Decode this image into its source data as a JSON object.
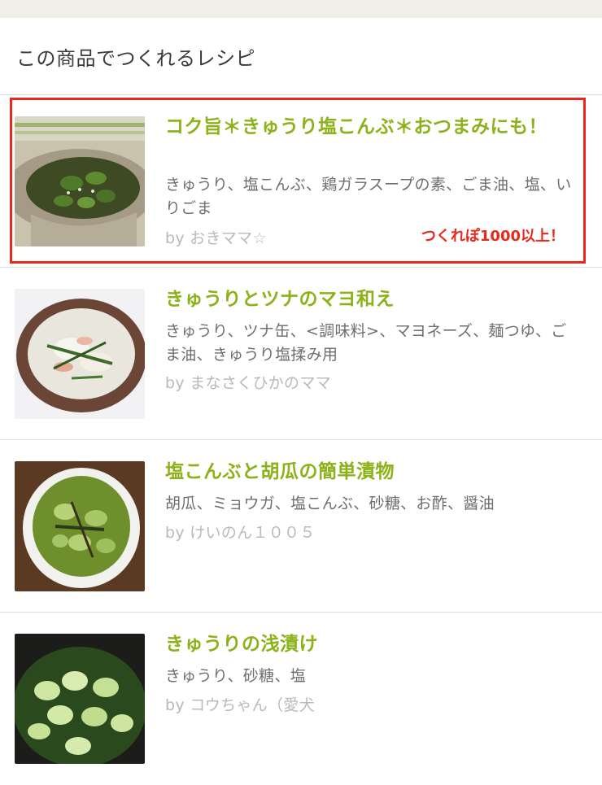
{
  "section": {
    "title": "この商品でつくれるレシピ"
  },
  "recipes": [
    {
      "title": "コク旨＊きゅうり塩こんぶ＊おつまみにも！",
      "ingredients": "きゅうり、塩こんぶ、鶏ガラスープの素、ごま油、塩、いりごま",
      "author": "by おきママ☆",
      "badge": "つくれぽ1000以上！"
    },
    {
      "title": "きゅうりとツナのマヨ和え",
      "ingredients": "きゅうり、ツナ缶、<調味料>、マヨネーズ、麺つゆ、ごま油、きゅうり塩揉み用",
      "author": "by まなさくひかのママ"
    },
    {
      "title": "塩こんぶと胡瓜の簡単漬物",
      "ingredients": "胡瓜、ミョウガ、塩こんぶ、砂糖、お酢、醤油",
      "author": "by けいのん１００５"
    },
    {
      "title": "きゅうりの浅漬け",
      "ingredients": "きゅうり、砂糖、塩",
      "author": "by コウちゃん（愛犬"
    }
  ],
  "colors": {
    "title_green": "#8cb21a",
    "highlight_red": "#e8291c",
    "ingredient_gray": "#6e6e6e",
    "author_gray": "#b9b9b9"
  }
}
